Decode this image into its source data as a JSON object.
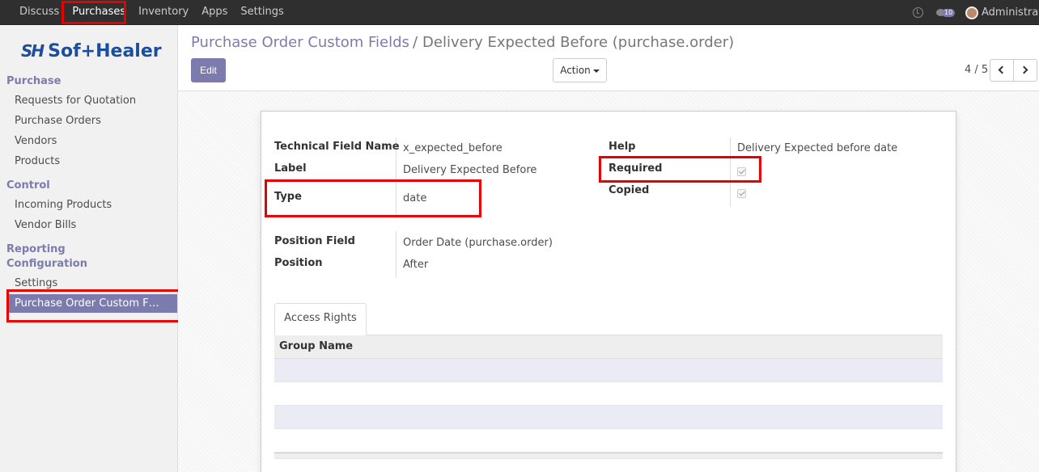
{
  "topbar": {
    "menu": [
      "Discuss",
      "Purchases",
      "Inventory",
      "Apps",
      "Settings"
    ],
    "active": "Purchases",
    "message_count": "10",
    "user": "Administrator"
  },
  "sidebar": {
    "logo_mark": "SH",
    "logo_text": "Sof+Healer",
    "sections": [
      {
        "heading": "Purchase",
        "items": [
          "Requests for Quotation",
          "Purchase Orders",
          "Vendors",
          "Products"
        ]
      },
      {
        "heading": "Control",
        "items": [
          "Incoming Products",
          "Vendor Bills"
        ]
      },
      {
        "heading": "Reporting",
        "items": []
      },
      {
        "heading": "Configuration",
        "items": [
          "Settings",
          "Purchase Order Custom F…"
        ]
      }
    ],
    "active_item": "Purchase Order Custom F…"
  },
  "breadcrumb": {
    "parent": "Purchase Order Custom Fields",
    "separator": "/",
    "current": "Delivery Expected Before (purchase.order)"
  },
  "buttons": {
    "edit": "Edit",
    "action": "Action"
  },
  "pager": {
    "value": "4 / 5"
  },
  "form": {
    "left": [
      {
        "label": "Technical Field Name",
        "value": "x_expected_before"
      },
      {
        "label": "Label",
        "value": "Delivery Expected Before"
      },
      {
        "label": "Type",
        "value": "date"
      }
    ],
    "left2": [
      {
        "label": "Position Field",
        "value": "Order Date (purchase.order)"
      },
      {
        "label": "Position",
        "value": "After"
      }
    ],
    "right": [
      {
        "label": "Help",
        "value": "Delivery Expected before date"
      },
      {
        "label": "Required",
        "checked": true
      },
      {
        "label": "Copied",
        "checked": true
      }
    ]
  },
  "tabs": [
    "Access Rights"
  ],
  "table": {
    "columns": [
      "Group Name"
    ],
    "rows": []
  },
  "colors": {
    "accent": "#7c7bad",
    "navbar": "#2f2f2f",
    "highlight": "#e60000"
  }
}
